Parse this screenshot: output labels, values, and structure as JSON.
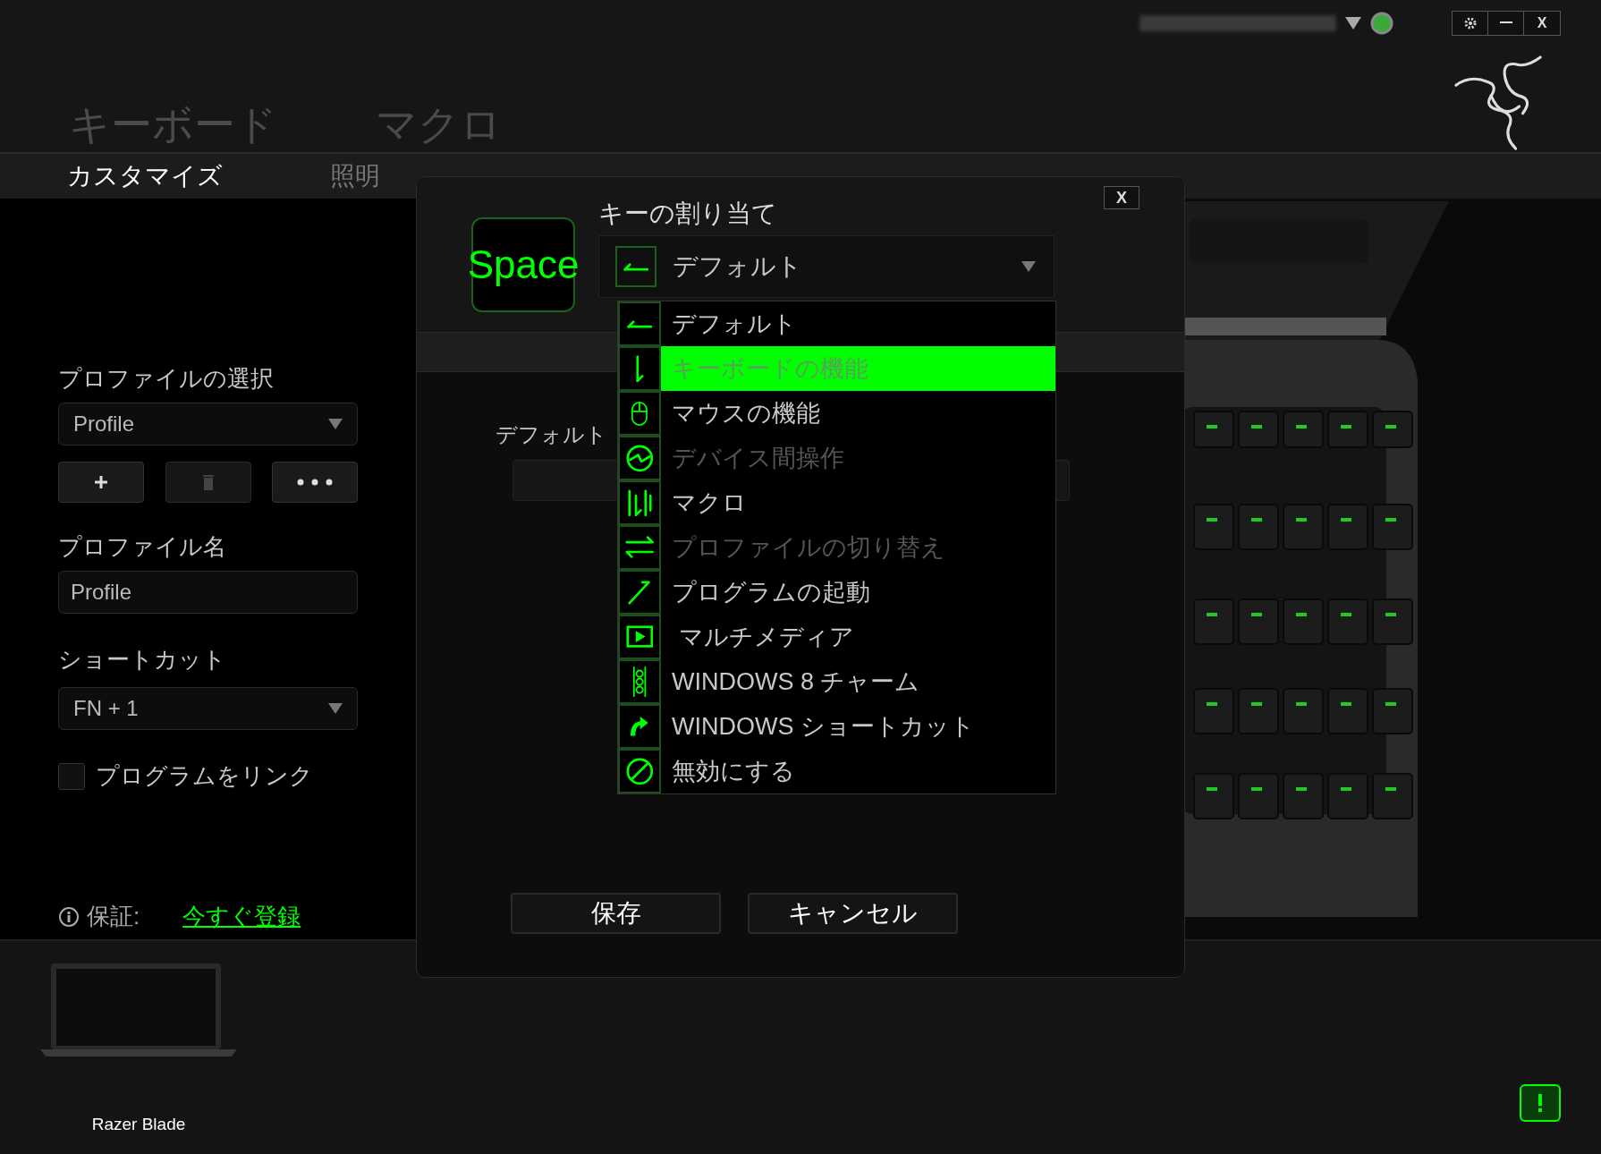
{
  "top_bar": {
    "close_label": "X"
  },
  "main_tabs": [
    {
      "label": "キーボード"
    },
    {
      "label": "マクロ"
    }
  ],
  "sub_tabs": [
    {
      "label": "カスタマイズ",
      "selected": true
    },
    {
      "label": "照明",
      "selected": false
    }
  ],
  "sidebar": {
    "profile_select": {
      "label": "プロファイルの選択",
      "value": "Profile"
    },
    "profile_name": {
      "label": "プロファイル名",
      "value": "Profile"
    },
    "shortcut": {
      "label": "ショートカット",
      "value": "FN + 1"
    },
    "link_program": {
      "label": "プログラムをリンク",
      "checked": false
    },
    "warranty": {
      "label": "保証:",
      "link": "今すぐ登録"
    }
  },
  "device": {
    "name": "Razer Blade"
  },
  "modal": {
    "key_label": "Space",
    "title": "キーの割り当て",
    "close_label": "X",
    "dropdown": {
      "value": "デフォルト",
      "kind": "default"
    },
    "options": [
      {
        "label": "デフォルト",
        "kind": "default",
        "selected": false,
        "disabled": false
      },
      {
        "label": "キーボードの機能",
        "kind": "keyboard",
        "selected": true,
        "disabled": false
      },
      {
        "label": "マウスの機能",
        "kind": "mouse",
        "selected": false,
        "disabled": false
      },
      {
        "label": "デバイス間操作",
        "kind": "interdevice",
        "selected": false,
        "disabled": true
      },
      {
        "label": "マクロ",
        "kind": "macro",
        "selected": false,
        "disabled": false
      },
      {
        "label": "プロファイルの切り替え",
        "kind": "profile",
        "selected": false,
        "disabled": true
      },
      {
        "label": "プログラムの起動",
        "kind": "launch",
        "selected": false,
        "disabled": false
      },
      {
        "label": " マルチメディア",
        "kind": "multimedia",
        "selected": false,
        "disabled": false
      },
      {
        "label": "WINDOWS 8 チャーム",
        "kind": "charms",
        "selected": false,
        "disabled": false
      },
      {
        "label": "WINDOWS ショートカット",
        "kind": "shortcut",
        "selected": false,
        "disabled": false
      },
      {
        "label": "無効にする",
        "kind": "disable",
        "selected": false,
        "disabled": false
      }
    ],
    "field_label": "デフォルト",
    "buttons": [
      "保存",
      "キャンセル"
    ]
  }
}
